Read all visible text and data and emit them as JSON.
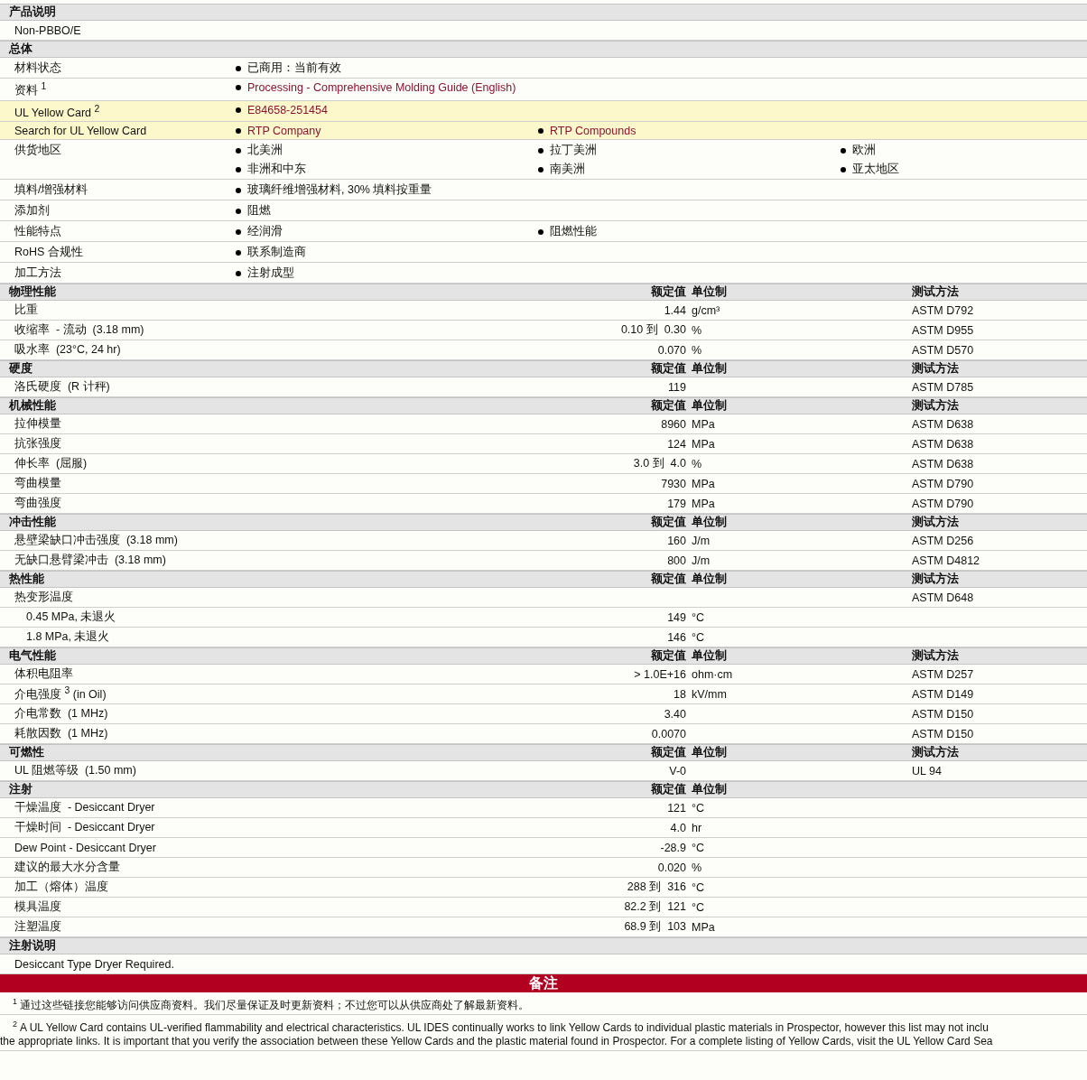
{
  "sections": [
    {
      "kind": "text",
      "title": "产品说明",
      "text": "Non-PBBO/E"
    },
    {
      "kind": "general",
      "title": "总体",
      "rows": [
        {
          "label": "材料状态",
          "highlighted": false,
          "link": false,
          "columns": [
            [
              "已商用：当前有效"
            ]
          ]
        },
        {
          "label": "资料 $^{1}$",
          "highlighted": false,
          "link": true,
          "columns": [
            [
              "Processing - Comprehensive Molding Guide (English)"
            ]
          ]
        },
        {
          "label": "UL Yellow Card $^{2}$",
          "highlighted": true,
          "link": true,
          "columns": [
            [
              "E84658-251454"
            ]
          ]
        },
        {
          "label": "Search for UL Yellow Card",
          "highlighted": true,
          "link": true,
          "columns": [
            [
              "RTP Company"
            ],
            [
              "RTP Compounds"
            ]
          ]
        },
        {
          "label": "供货地区",
          "highlighted": false,
          "link": false,
          "columns": [
            [
              "北美洲",
              "非洲和中东"
            ],
            [
              "拉丁美洲",
              "南美洲"
            ],
            [
              "欧洲",
              "亚太地区"
            ]
          ]
        },
        {
          "label": "填料/增强材料",
          "highlighted": false,
          "link": false,
          "columns": [
            [
              "玻璃纤维增强材料, 30% 填料按重量"
            ]
          ]
        },
        {
          "label": "添加剂",
          "highlighted": false,
          "link": false,
          "columns": [
            [
              "阻燃"
            ]
          ]
        },
        {
          "label": "性能特点",
          "highlighted": false,
          "link": false,
          "columns": [
            [
              "经润滑"
            ],
            [
              "阻燃性能"
            ]
          ]
        },
        {
          "label": "RoHS 合规性",
          "highlighted": false,
          "link": false,
          "columns": [
            [
              "联系制造商"
            ]
          ]
        },
        {
          "label": "加工方法",
          "highlighted": false,
          "link": false,
          "columns": [
            [
              "注射成型"
            ]
          ]
        }
      ]
    },
    {
      "kind": "properties",
      "title": "物理性能",
      "value_header": "额定值",
      "unit_header": "单位制",
      "method_header": "测试方法",
      "rows": [
        {
          "label": "比重",
          "value": "1.44",
          "unit": "g/cm³",
          "method": "ASTM D792"
        },
        {
          "label": "收缩率  - 流动  (3.18 mm)",
          "value": "0.10 到  0.30",
          "unit": "%",
          "method": "ASTM D955"
        },
        {
          "label": "吸水率  (23°C, 24 hr)",
          "value": "0.070",
          "unit": "%",
          "method": "ASTM D570"
        }
      ]
    },
    {
      "kind": "properties",
      "title": "硬度",
      "value_header": "额定值",
      "unit_header": "单位制",
      "method_header": "测试方法",
      "rows": [
        {
          "label": "洛氏硬度  (R 计秤)",
          "value": "119",
          "method": "ASTM D785"
        }
      ]
    },
    {
      "kind": "properties",
      "title": "机械性能",
      "value_header": "额定值",
      "unit_header": "单位制",
      "method_header": "测试方法",
      "rows": [
        {
          "label": "拉伸模量",
          "value": "8960",
          "unit": "MPa",
          "method": "ASTM D638"
        },
        {
          "label": "抗张强度",
          "value": "124",
          "unit": "MPa",
          "method": "ASTM D638"
        },
        {
          "label": "伸长率  (屈服)",
          "value": "3.0 到  4.0",
          "unit": "%",
          "method": "ASTM D638"
        },
        {
          "label": "弯曲模量",
          "value": "7930",
          "unit": "MPa",
          "method": "ASTM D790"
        },
        {
          "label": "弯曲强度",
          "value": "179",
          "unit": "MPa",
          "method": "ASTM D790"
        }
      ]
    },
    {
      "kind": "properties",
      "title": "冲击性能",
      "value_header": "额定值",
      "unit_header": "单位制",
      "method_header": "测试方法",
      "rows": [
        {
          "label": "悬壁梁缺口冲击强度  (3.18 mm)",
          "value": "160",
          "unit": "J/m",
          "method": "ASTM D256"
        },
        {
          "label": "无缺口悬臂梁冲击  (3.18 mm)",
          "value": "800",
          "unit": "J/m",
          "method": "ASTM D4812"
        }
      ]
    },
    {
      "kind": "properties",
      "title": "热性能",
      "value_header": "额定值",
      "unit_header": "单位制",
      "method_header": "测试方法",
      "rows": [
        {
          "label": "热变形温度",
          "method": "ASTM D648",
          "children": [
            {
              "label": "0.45 MPa, 未退火",
              "value": "149",
              "unit": "°C"
            },
            {
              "label": "1.8 MPa, 未退火",
              "value": "146",
              "unit": "°C"
            }
          ]
        }
      ]
    },
    {
      "kind": "properties",
      "title": "电气性能",
      "value_header": "额定值",
      "unit_header": "单位制",
      "method_header": "测试方法",
      "rows": [
        {
          "label": "体积电阻率",
          "value": "> 1.0E+16",
          "unit": "ohm·cm",
          "method": "ASTM D257"
        },
        {
          "label": "介电强度 $^{3}$ (in Oil)",
          "value": "18",
          "unit": "kV/mm",
          "method": "ASTM D149"
        },
        {
          "label": "介电常数  (1 MHz)",
          "value": "3.40",
          "method": "ASTM D150"
        },
        {
          "label": "耗散因数  (1 MHz)",
          "value": "0.0070",
          "method": "ASTM D150"
        }
      ]
    },
    {
      "kind": "properties",
      "title": "可燃性",
      "value_header": "额定值",
      "unit_header": "单位制",
      "method_header": "测试方法",
      "rows": [
        {
          "label": "UL 阻燃等级  (1.50 mm)",
          "value": "V-0",
          "method": "UL 94"
        }
      ]
    },
    {
      "kind": "properties",
      "title": "注射",
      "value_header": "额定值",
      "unit_header": "单位制",
      "rows": [
        {
          "label": "干燥温度  - Desiccant Dryer",
          "value": "121",
          "unit": "°C"
        },
        {
          "label": "干燥时间  - Desiccant Dryer",
          "value": "4.0",
          "unit": "hr"
        },
        {
          "label": "Dew Point - Desiccant Dryer",
          "value": "-28.9",
          "unit": "°C"
        },
        {
          "label": "建议的最大水分含量",
          "value": "0.020",
          "unit": "%"
        },
        {
          "label": "加工（熔体）温度",
          "value": "288 到  316",
          "unit": "°C"
        },
        {
          "label": "模具温度",
          "value": "82.2 到  121",
          "unit": "°C"
        },
        {
          "label": "注塑温度",
          "value": "68.9 到  103",
          "unit": "MPa"
        }
      ]
    },
    {
      "kind": "text",
      "title": "注射说明",
      "text": "Desiccant Type Dryer Required."
    }
  ],
  "notes": {
    "title": "备注",
    "footnotes": [
      {
        "mark": "1",
        "lines": [
          "通过这些链接您能够访问供应商资料。我们尽量保证及时更新资料；不过您可以从供应商处了解最新资料。"
        ]
      },
      {
        "mark": "2",
        "lines": [
          "A UL Yellow Card contains UL-verified flammability and electrical characteristics. UL IDES continually works to link Yellow Cards to individual plastic materials in Prospector, however this list may not inclu",
          "the appropriate links. It is important that you verify the association between these Yellow Cards and the plastic material found in Prospector. For a complete listing of Yellow Cards, visit the UL Yellow Card Sea"
        ]
      }
    ]
  }
}
